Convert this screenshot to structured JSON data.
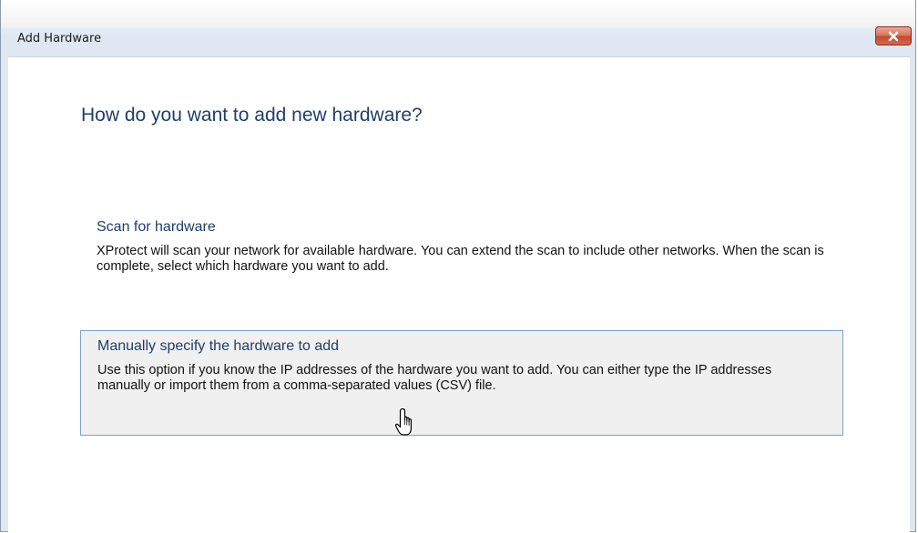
{
  "window": {
    "title": "Add Hardware",
    "close_icon": "close-icon"
  },
  "main": {
    "heading": "How do you want to add new hardware?",
    "options": [
      {
        "title": "Scan for hardware",
        "description": "XProtect will scan your network for available hardware. You can extend the scan to include other networks. When the scan is complete, select which hardware you want to add."
      },
      {
        "title": "Manually specify the hardware to add",
        "description": "Use this option if you know the IP addresses of the hardware you want to add. You can either type the IP addresses manually or import them from a comma-separated values (CSV) file.",
        "highlighted": true
      }
    ]
  },
  "cursor": {
    "icon": "hand-pointer-icon"
  },
  "colors": {
    "heading": "#1e3f6a",
    "highlight_border": "#7da2ce",
    "highlight_bg": "#f0f0f0",
    "close_button": "#c44a2e"
  }
}
